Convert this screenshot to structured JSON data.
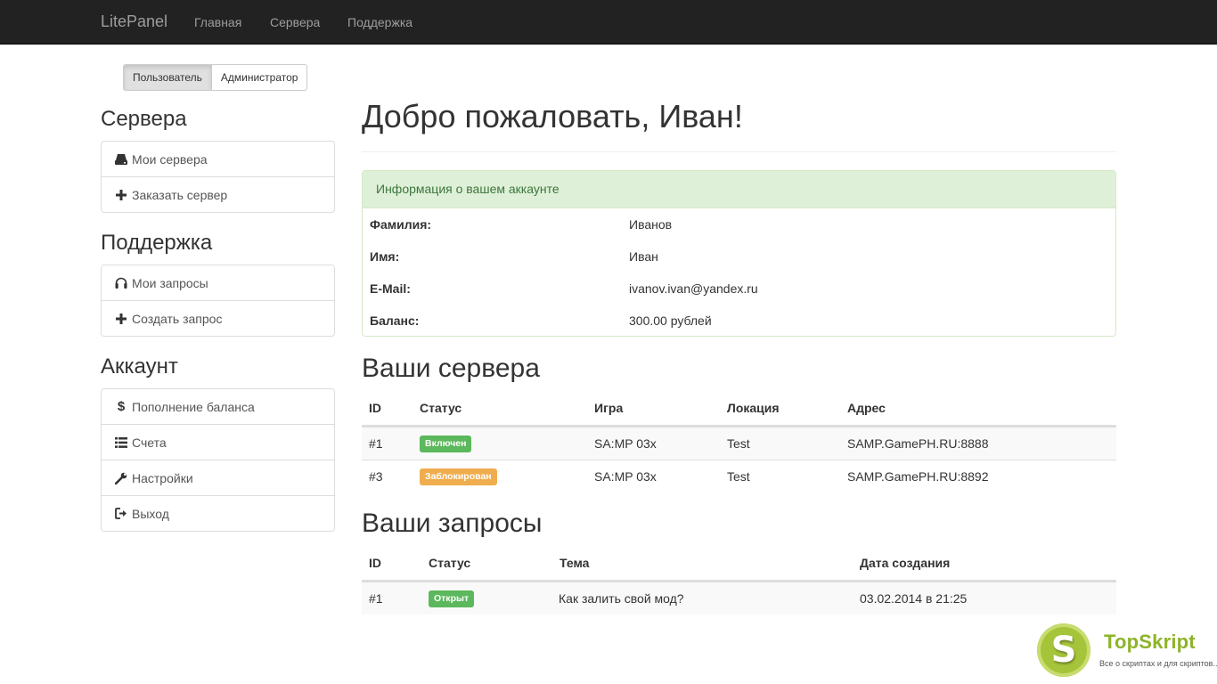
{
  "navbar": {
    "brand": "LitePanel",
    "links": [
      "Главная",
      "Сервера",
      "Поддержка"
    ]
  },
  "role_toggle": {
    "user": "Пользователь",
    "admin": "Администратор",
    "active": "user"
  },
  "sidebar": {
    "servers": {
      "heading": "Сервера",
      "items": [
        {
          "label": "Мои сервера",
          "icon": "hdd-icon"
        },
        {
          "label": "Заказать сервер",
          "icon": "plus-icon"
        }
      ]
    },
    "support": {
      "heading": "Поддержка",
      "items": [
        {
          "label": "Мои запросы",
          "icon": "headphones-icon"
        },
        {
          "label": "Создать запрос",
          "icon": "plus-icon"
        }
      ]
    },
    "account": {
      "heading": "Аккаунт",
      "items": [
        {
          "label": "Пополнение баланса",
          "icon": "dollar-icon"
        },
        {
          "label": "Счета",
          "icon": "list-icon"
        },
        {
          "label": "Настройки",
          "icon": "wrench-icon"
        },
        {
          "label": "Выход",
          "icon": "logout-icon"
        }
      ]
    }
  },
  "main": {
    "title": "Добро пожаловать, Иван!",
    "account_panel": {
      "heading": "Информация о вашем аккаунте",
      "rows": [
        {
          "key": "Фамилия:",
          "value": "Иванов"
        },
        {
          "key": "Имя:",
          "value": "Иван"
        },
        {
          "key": "E-Mail:",
          "value": "ivanov.ivan@yandex.ru"
        },
        {
          "key": "Баланс:",
          "value": "300.00 рублей"
        }
      ]
    },
    "servers": {
      "title": "Ваши сервера",
      "headers": [
        "ID",
        "Статус",
        "Игра",
        "Локация",
        "Адрес"
      ],
      "rows": [
        {
          "id": "#1",
          "status": "Включен",
          "status_color": "#5cb85c",
          "game": "SA:MP 03x",
          "location": "Test",
          "address": "SAMP.GamePH.RU:8888"
        },
        {
          "id": "#3",
          "status": "Заблокирован",
          "status_color": "#f0ad4e",
          "game": "SA:MP 03x",
          "location": "Test",
          "address": "SAMP.GamePH.RU:8892"
        }
      ]
    },
    "tickets": {
      "title": "Ваши запросы",
      "headers": [
        "ID",
        "Статус",
        "Тема",
        "Дата создания"
      ],
      "rows": [
        {
          "id": "#1",
          "status": "Открыт",
          "status_color": "#5cb85c",
          "subject": "Как залить свой мод?",
          "created": "03.02.2014 в 21:25"
        }
      ]
    }
  },
  "watermark": {
    "letter": "S",
    "brand": "TopSkript",
    "tagline": "Все о скриптах и для скриптов..."
  },
  "colors": {
    "navbar": "#222222",
    "success": "#5cb85c",
    "warning": "#f0ad4e",
    "panel_heading": "#dff0d8"
  }
}
